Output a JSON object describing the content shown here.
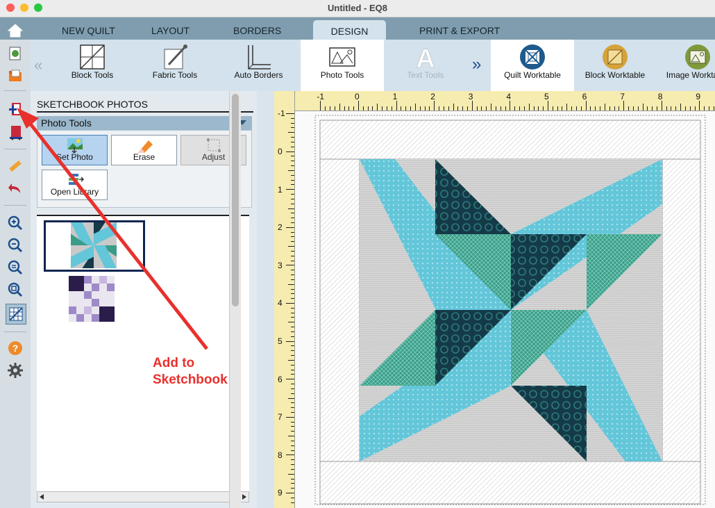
{
  "window": {
    "title": "Untitled - EQ8"
  },
  "colors": {
    "accent_blue": "#63c6d9",
    "teal": "#3a9c87",
    "navy": "#143a48",
    "gray_fabric": "#c9c9c9",
    "arrow_red": "#e8312c"
  },
  "tabs": [
    {
      "label": "NEW QUILT"
    },
    {
      "label": "LAYOUT"
    },
    {
      "label": "BORDERS"
    },
    {
      "label": "DESIGN",
      "active": true
    },
    {
      "label": "PRINT & EXPORT"
    }
  ],
  "ribbon": {
    "tools": [
      {
        "label": "Block Tools",
        "icon": "block-tools-icon"
      },
      {
        "label": "Fabric Tools",
        "icon": "fabric-tools-icon"
      },
      {
        "label": "Auto Borders",
        "icon": "auto-borders-icon"
      },
      {
        "label": "Photo Tools",
        "icon": "photo-tools-icon",
        "active": true
      },
      {
        "label": "Text Tools",
        "icon": "text-tools-icon",
        "disabled": true
      },
      {
        "label": "Quilt Worktable",
        "icon": "quilt-worktable-icon"
      },
      {
        "label": "Block Worktable",
        "icon": "block-worktable-icon"
      },
      {
        "label": "Image Worktable",
        "icon": "image-worktable-icon"
      }
    ]
  },
  "sketchbook": {
    "title": "SKETCHBOOK PHOTOS",
    "photo_tools_header": "Photo Tools",
    "buttons": [
      {
        "label": "Set Photo",
        "icon": "set-photo-icon",
        "active": true
      },
      {
        "label": "Erase",
        "icon": "eraser-icon"
      },
      {
        "label": "Adjust",
        "icon": "adjust-icon",
        "disabled": true
      },
      {
        "label": "Open Library",
        "icon": "open-library-icon"
      }
    ]
  },
  "rulers": {
    "top": [
      "-1",
      "0",
      "1",
      "2",
      "3",
      "4",
      "5",
      "6",
      "7",
      "8",
      "9"
    ],
    "left": [
      "-1",
      "0",
      "1",
      "2",
      "3",
      "4",
      "5",
      "6",
      "7",
      "8",
      "9"
    ]
  },
  "annotation": {
    "line1": "Add to",
    "line2": "Sketchbook"
  }
}
